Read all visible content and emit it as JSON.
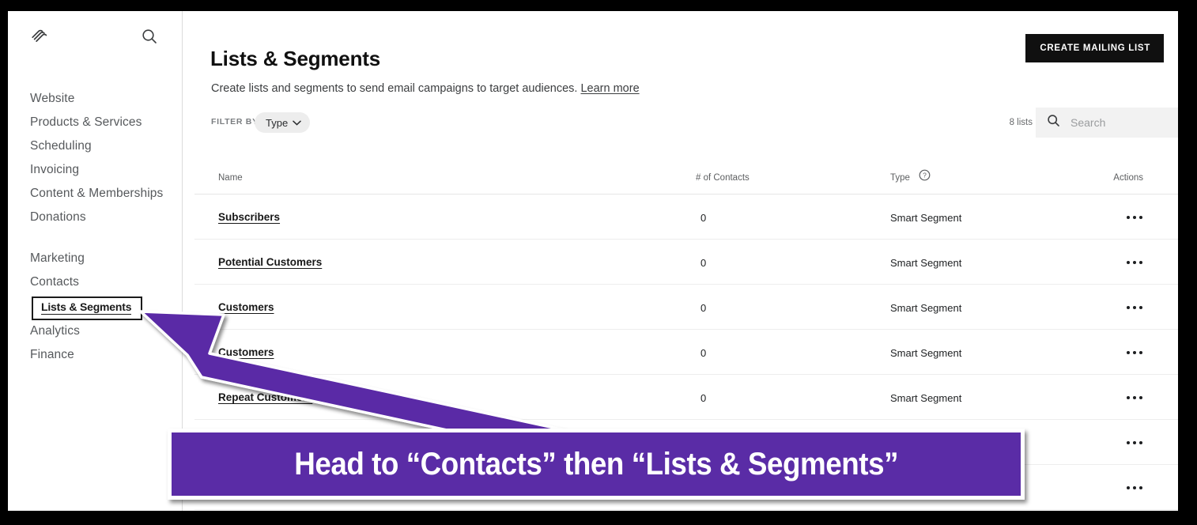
{
  "sidebar": {
    "logo_icon": "squarespace-logo",
    "search_icon": "search-icon",
    "items": [
      {
        "label": "Website",
        "active": false
      },
      {
        "label": "Products & Services",
        "active": false
      },
      {
        "label": "Scheduling",
        "active": false
      },
      {
        "label": "Invoicing",
        "active": false
      },
      {
        "label": "Content & Memberships",
        "active": false
      },
      {
        "label": "Donations",
        "active": false
      },
      {
        "label": "Marketing",
        "active": false
      },
      {
        "label": "Contacts",
        "active": false
      },
      {
        "label": "Lists & Segments",
        "active": true
      },
      {
        "label": "Analytics",
        "active": false
      },
      {
        "label": "Finance",
        "active": false
      }
    ]
  },
  "header": {
    "title": "Lists & Segments",
    "subtitle": "Create lists and segments to send email campaigns to target audiences.",
    "subtitle_link": "Learn more",
    "create_button": "CREATE MAILING LIST"
  },
  "toolbar": {
    "filter_by_label": "FILTER BY",
    "filter_pill_label": "Type",
    "filter_pill_icon": "chevron-down-icon",
    "list_count": "8 lists",
    "search_icon": "search-icon",
    "search_placeholder": "Search",
    "search_value": ""
  },
  "table": {
    "columns": {
      "name": "Name",
      "contacts": "# of Contacts",
      "type": "Type",
      "actions": "Actions"
    },
    "type_help_icon": "help-circle-icon",
    "row_action_icon": "more-horizontal-icon",
    "rows": [
      {
        "name": "Subscribers",
        "contacts": "0",
        "type": "Smart Segment"
      },
      {
        "name": "Potential Customers",
        "contacts": "0",
        "type": "Smart Segment"
      },
      {
        "name": "Customers",
        "contacts": "0",
        "type": "Smart Segment"
      },
      {
        "name": "Customers",
        "contacts": "0",
        "type": "Smart Segment"
      },
      {
        "name": "Repeat Customers",
        "contacts": "0",
        "type": "Smart Segment"
      },
      {
        "name": "",
        "contacts": "",
        "type": ""
      },
      {
        "name": "",
        "contacts": "",
        "type": ""
      }
    ]
  },
  "annotation": {
    "banner_text": "Head to “Contacts” then “Lists & Segments”",
    "accent_color": "#5a2ca6",
    "arrow_icon": "callout-arrow-icon"
  }
}
